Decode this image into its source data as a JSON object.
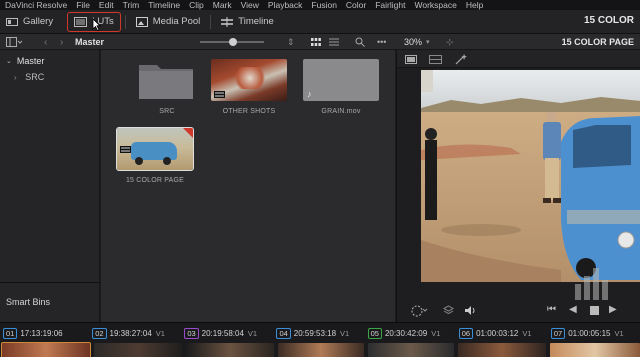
{
  "menubar": {
    "items": [
      "DaVinci Resolve",
      "File",
      "Edit",
      "Trim",
      "Timeline",
      "Clip",
      "Mark",
      "View",
      "Playback",
      "Fusion",
      "Color",
      "Fairlight",
      "Workspace",
      "Help"
    ]
  },
  "toolbar": {
    "gallery_label": "Gallery",
    "luts_label": "LUTs",
    "media_pool_label": "Media Pool",
    "timeline_label": "Timeline",
    "project_title": "15 COLOR"
  },
  "subbar": {
    "folder_label": "Master",
    "zoom": "30%",
    "viewer_title": "15 COLOR PAGE"
  },
  "sidebar": {
    "root_label": "Master",
    "children": [
      "SRC"
    ],
    "smart_bins_label": "Smart Bins"
  },
  "media_pool": {
    "clips": [
      {
        "name": "SRC",
        "kind": "folder"
      },
      {
        "name": "OTHER SHOTS",
        "kind": "timeline"
      },
      {
        "name": "GRAIN.mov",
        "kind": "audio"
      },
      {
        "name": "15 COLOR PAGE",
        "kind": "timeline"
      }
    ]
  },
  "timeline_strip": [
    {
      "num": "01",
      "tc": "17:13:19:06",
      "track": "",
      "color": "#3b8fd8"
    },
    {
      "num": "02",
      "tc": "19:38:27:04",
      "track": "V1",
      "color": "#3b8fd8"
    },
    {
      "num": "03",
      "tc": "20:19:58:04",
      "track": "V1",
      "color": "#9a4bd0"
    },
    {
      "num": "04",
      "tc": "20:59:53:18",
      "track": "V1",
      "color": "#3b8fd8"
    },
    {
      "num": "05",
      "tc": "20:30:42:09",
      "track": "V1",
      "color": "#3aa648"
    },
    {
      "num": "06",
      "tc": "01:00:03:12",
      "track": "V1",
      "color": "#3b8fd8"
    },
    {
      "num": "07",
      "tc": "01:00:05:15",
      "track": "V1",
      "color": "#3b8fd8"
    }
  ],
  "colors": {
    "highlight": "#d0382b",
    "accent": "#3b8fd8"
  }
}
